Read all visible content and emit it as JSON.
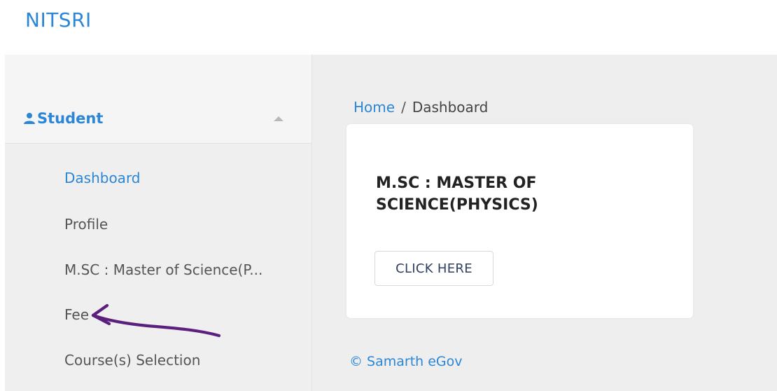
{
  "brand": {
    "title": "NITSRI"
  },
  "sidebar": {
    "section_label": "Student",
    "section_icon": "user-icon",
    "collapse_icon": "caret-up-icon",
    "items": [
      {
        "label": "Dashboard",
        "active": true
      },
      {
        "label": "Profile",
        "active": false
      },
      {
        "label": "M.SC : Master of Science(P...",
        "active": false
      },
      {
        "label": "Fee",
        "active": false
      },
      {
        "label": "Course(s) Selection",
        "active": false
      }
    ]
  },
  "breadcrumb": {
    "home": "Home",
    "separator": "/",
    "current": "Dashboard"
  },
  "card": {
    "title": "M.SC : MASTER OF SCIENCE(PHYSICS)",
    "button_label": "CLICK HERE"
  },
  "footer": {
    "text": "© Samarth eGov"
  },
  "colors": {
    "accent": "#2c86d6",
    "annotation": "#5b1f7d"
  }
}
